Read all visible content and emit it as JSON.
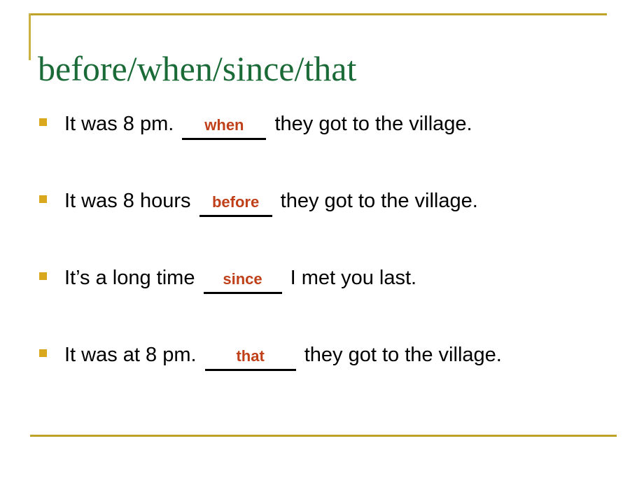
{
  "slide": {
    "title": "before/when/since/that",
    "title_color": "#1b6b38",
    "accent_rule_color": "#bfa22a",
    "bullet_marker_color": "#d9a81c",
    "answer_color": "#c0401a",
    "body_color": "#000000",
    "background_color": "#ffffff",
    "bullets": [
      {
        "marker": "square-bullet",
        "before_blank": "It was 8 pm.",
        "answer": "when",
        "after_blank": "they got to the village."
      },
      {
        "marker": "square-bullet",
        "before_blank": "It was 8 hours",
        "answer": "before",
        "after_blank": "they got to the village."
      },
      {
        "marker": "square-bullet",
        "before_blank": "It’s a long time",
        "answer": "since",
        "after_blank": "I met you last."
      },
      {
        "marker": "square-bullet",
        "before_blank": "It was at 8 pm.",
        "answer": "that",
        "after_blank": "they got to the village."
      }
    ]
  }
}
